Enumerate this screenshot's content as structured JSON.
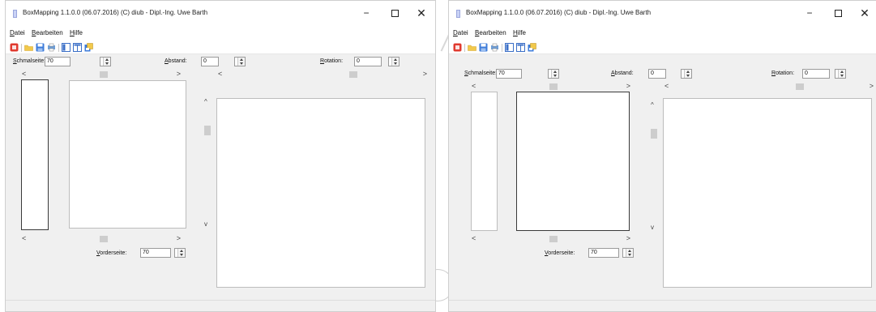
{
  "window": {
    "title": "BoxMapping 1.1.0.0  (06.07.2016) (C) diub - Dipl.-Ing. Uwe Barth",
    "minimize_glyph": "−",
    "close_glyph": "✕"
  },
  "menu": {
    "items": [
      {
        "label_ul": "D",
        "label_rest": "atei"
      },
      {
        "label_ul": "B",
        "label_rest": "earbeiten"
      },
      {
        "label_ul": "H",
        "label_rest": "ilfe"
      }
    ]
  },
  "toolbar": {
    "icons": [
      "close-icon",
      "open-folder-icon",
      "save-icon",
      "print-icon",
      "layout-single-icon",
      "layout-double-icon",
      "export-icon"
    ],
    "colors": {
      "close": "#e03a2f",
      "folder": "#f2c94c",
      "save": "#3d7bd9",
      "view": "#3b6fc7"
    }
  },
  "controls": {
    "schmalseite": {
      "label_ul": "S",
      "label_rest": "chmalseite:",
      "value": "70"
    },
    "abstand": {
      "label_ul": "A",
      "label_rest": "bstand:",
      "value": "0"
    },
    "rotation": {
      "label_ul": "R",
      "label_rest": "otation:",
      "value": "0"
    },
    "vorderseite": {
      "label_ul": "V",
      "label_rest": "orderseite:",
      "value": "70"
    }
  },
  "scroll": {
    "left_arrow": "<",
    "right_arrow": ">",
    "up_arrow": "^",
    "down_arrow": "v"
  }
}
